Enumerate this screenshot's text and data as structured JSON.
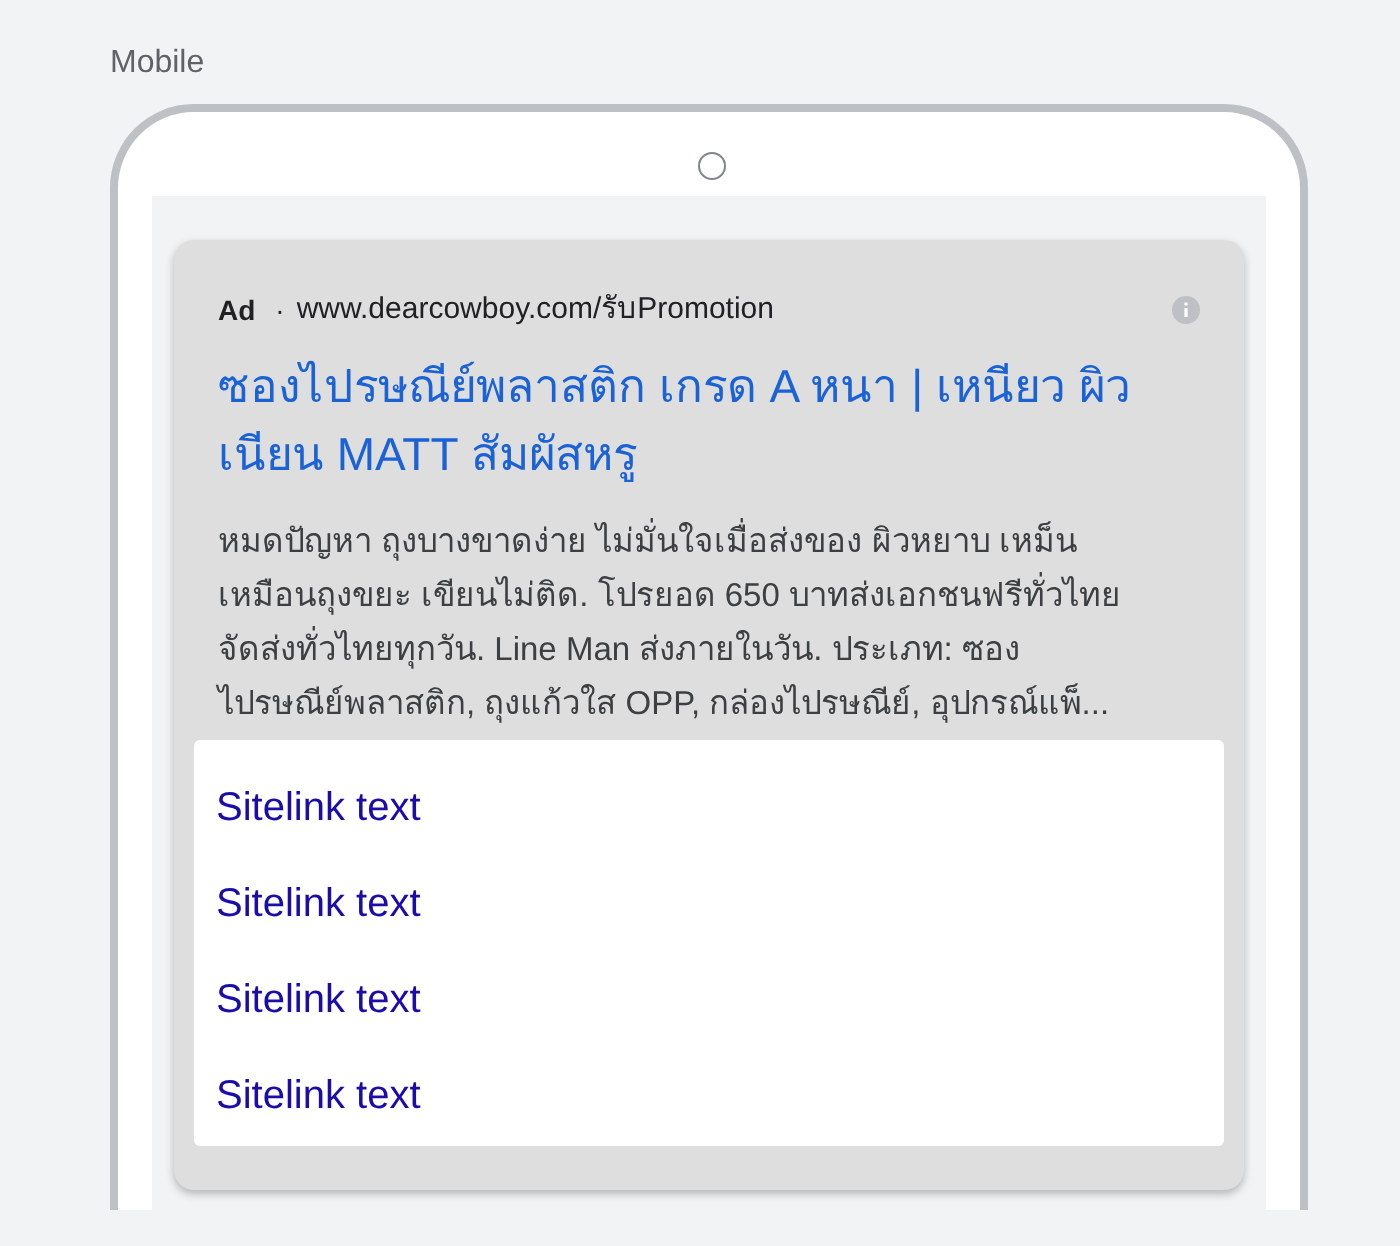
{
  "section_label": "Mobile",
  "ad": {
    "badge": "Ad",
    "separator": "·",
    "url": "www.dearcowboy.com/รับPromotion",
    "headline_lines": [
      "ซองไปรษณีย์พลาสติก เกรด A หนา | เหนียว ผิว",
      "เนียน MATT สัมผัสหรู"
    ],
    "description_lines": [
      "หมดปัญหา ถุงบางขาดง่าย ไม่มั่นใจเมื่อส่งของ ผิวหยาบ เหม็น",
      "เหมือนถุงขยะ เขียนไม่ติด. โปรยอด 650 บาทส่งเอกชนฟรีทั่วไทย",
      "จัดส่งทั่วไทยทุกวัน. Line Man ส่งภายในวัน. ประเภท: ซอง",
      "ไปรษณีย์พลาสติก, ถุงแก้วใส OPP, กล่องไปรษณีย์, อุปกรณ์แพ็..."
    ],
    "sitelinks": [
      "Sitelink text",
      "Sitelink text",
      "Sitelink text",
      "Sitelink text"
    ]
  }
}
